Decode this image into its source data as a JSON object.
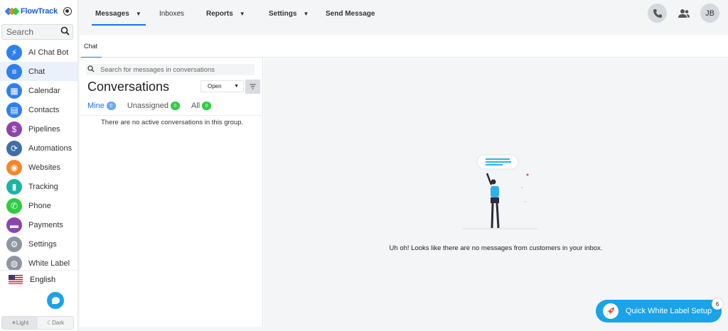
{
  "brand": {
    "name": "FlowTrack"
  },
  "sidebar": {
    "search_placeholder": "Search",
    "items": [
      {
        "label": "AI Chat Bot",
        "icon": "bolt-icon",
        "color": "#2f80ed",
        "glyph": "⚡"
      },
      {
        "label": "Chat",
        "icon": "chat-icon",
        "color": "#2f80ed",
        "glyph": "≡",
        "active": true
      },
      {
        "label": "Calendar",
        "icon": "calendar-icon",
        "color": "#2f80ed",
        "glyph": "▦"
      },
      {
        "label": "Contacts",
        "icon": "contacts-icon",
        "color": "#2f80ed",
        "glyph": "▤"
      },
      {
        "label": "Pipelines",
        "icon": "dollar-icon",
        "color": "#8e44ad",
        "glyph": "$"
      },
      {
        "label": "Automations",
        "icon": "automation-icon",
        "color": "#3d6ea8",
        "glyph": "⟳"
      },
      {
        "label": "Websites",
        "icon": "globe-icon",
        "color": "#f2862a",
        "glyph": "◉"
      },
      {
        "label": "Tracking",
        "icon": "bar-chart-icon",
        "color": "#1bb5a4",
        "glyph": "▮"
      },
      {
        "label": "Phone",
        "icon": "phone-icon",
        "color": "#2ecc40",
        "glyph": "✆"
      },
      {
        "label": "Payments",
        "icon": "card-icon",
        "color": "#8e44ad",
        "glyph": "▬"
      },
      {
        "label": "Settings",
        "icon": "gear-icon",
        "color": "#8d96a0",
        "glyph": "⚙"
      },
      {
        "label": "White Label",
        "icon": "palette-icon",
        "color": "#8d96a0",
        "glyph": "◍"
      }
    ],
    "language": "English",
    "theme_light": "Light",
    "theme_dark": "Dark"
  },
  "topbar": {
    "tabs": [
      {
        "label": "Messages",
        "has_caret": true,
        "active": true
      },
      {
        "label": "Inboxes",
        "has_caret": false
      },
      {
        "label": "Reports",
        "has_caret": true
      },
      {
        "label": "Settings",
        "has_caret": true
      },
      {
        "label": "Send Message",
        "has_caret": false
      }
    ],
    "avatar_initials": "JB"
  },
  "panel": {
    "tab": "Chat",
    "search_placeholder": "Search for messages in conversations",
    "title": "Conversations",
    "status_value": "Open",
    "subtabs": [
      {
        "label": "Mine",
        "count": "0",
        "color": "#6aa8f0",
        "active": true
      },
      {
        "label": "Unassigned",
        "count": "0",
        "color": "#2ecc40"
      },
      {
        "label": "All",
        "count": "0",
        "color": "#2ecc40"
      }
    ],
    "empty_list_text": "There are no active conversations in this group.",
    "empty_detail_text": "Uh oh! Looks like there are no messages from customers in your inbox."
  },
  "quick_setup": {
    "label": "Quick White Label Setup",
    "count": "6"
  }
}
